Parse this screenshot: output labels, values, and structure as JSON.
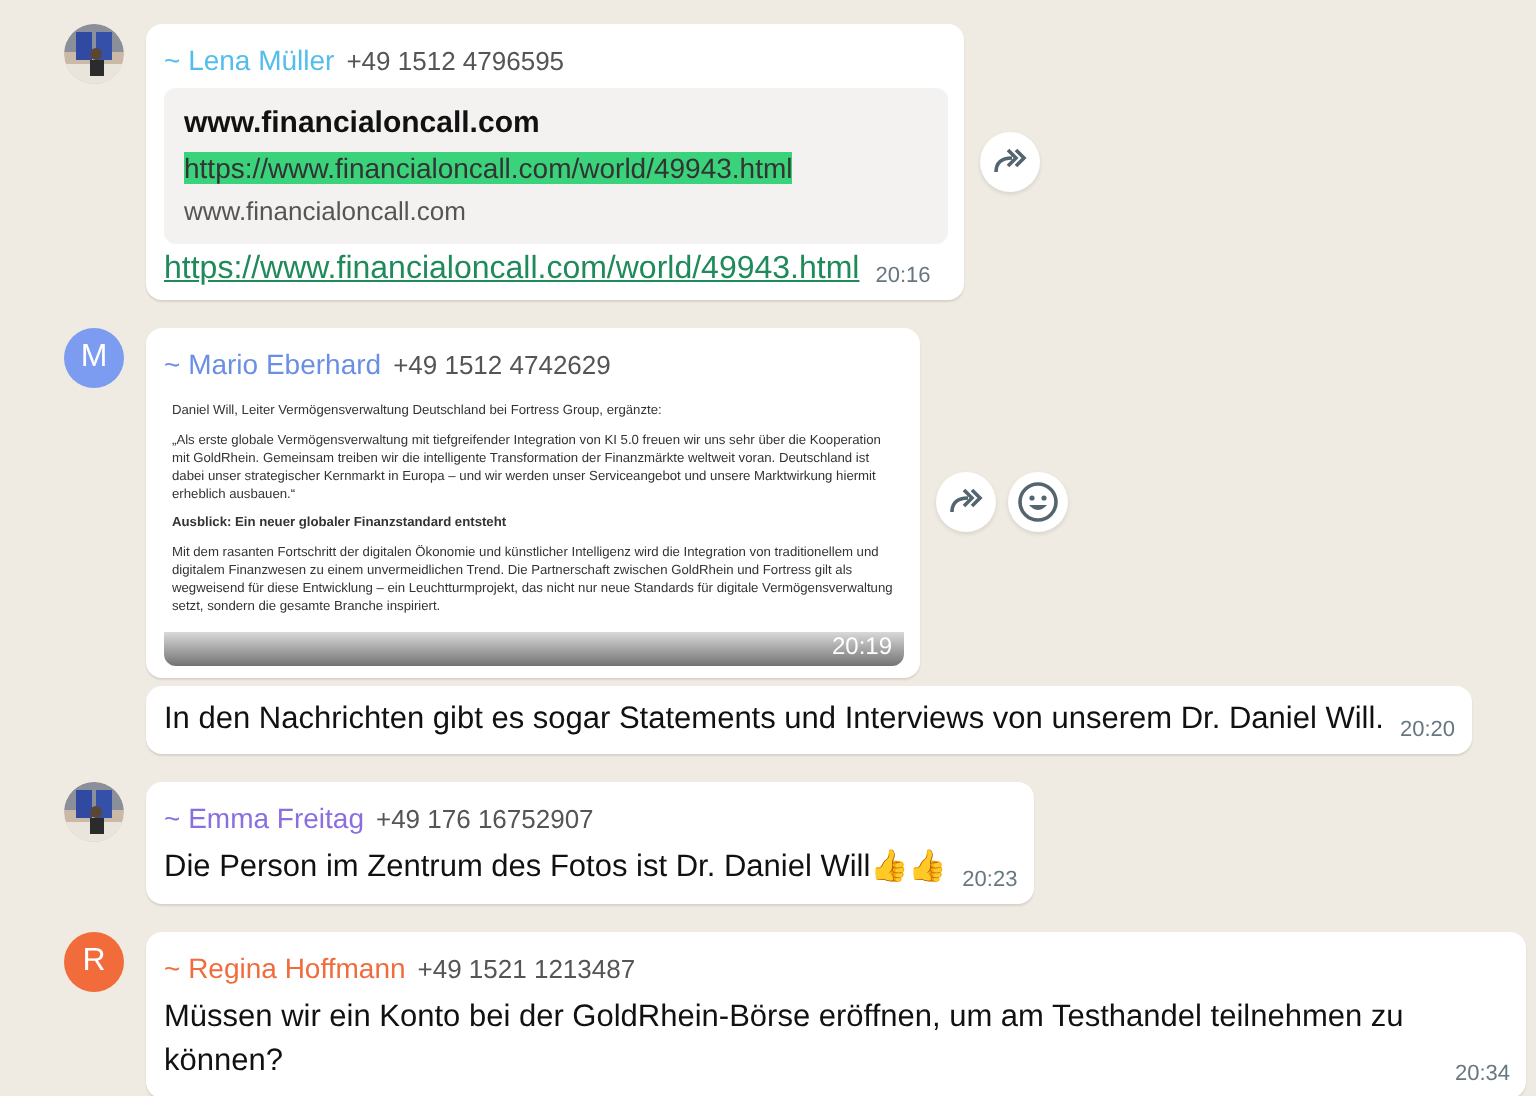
{
  "messages": [
    {
      "kind": "link",
      "sender": {
        "name": "~ Lena Müller",
        "phone": "+49 1512 4796595",
        "color": "#53bdeb"
      },
      "preview": {
        "title": "www.financialoncall.com",
        "url": "https://www.financialoncall.com/world/49943.html",
        "domain": "www.financialoncall.com",
        "highlighted": true
      },
      "text": "https://www.financialoncall.com/world/49943.html",
      "time": "20:16",
      "forward": true,
      "react": false
    },
    {
      "sender": {
        "name": "~ Mario Eberhard",
        "phone": "+49 1512 4742629",
        "color": "#6c8fe6"
      },
      "avatar": {
        "kind": "letter",
        "letter": "M",
        "color": "#7b9cf0"
      },
      "document": [
        {
          "kind": "text",
          "text": "Daniel Will, Leiter Vermögensverwaltung Deutschland bei Fortress Group, ergänzte:"
        },
        {
          "kind": "text",
          "text": "„Als erste globale Vermögensverwaltung mit tiefgreifender Integration von KI 5.0 freuen wir uns sehr über die Kooperation mit GoldRhein. Gemeinsam treiben wir die intelligente Transformation der Finanzmärkte weltweit voran. Deutschland ist dabei unser strategischer Kernmarkt in Europa – und wir werden unser Serviceangebot und unsere Marktwirkung hiermit erheblich ausbauen.“"
        },
        {
          "kind": "heading",
          "text": "Ausblick: Ein neuer globaler Finanzstandard entsteht"
        },
        {
          "kind": "text",
          "text": "Mit dem rasanten Fortschritt der digitalen Ökonomie und künstlicher Intelligenz wird die Integration von traditionellem und digitalem Finanzwesen zu einem unvermeidlichen Trend. Die Partnerschaft zwischen GoldRhein und Fortress gilt als wegweisend für diese Entwicklung – ein Leuchtturmprojekt, das nicht nur neue Standards für digitale Vermögensverwaltung setzt, sondern die gesamte Branche inspiriert."
        }
      ],
      "time": "20:19",
      "forward": true,
      "react": true
    },
    {
      "kind": "text",
      "text": "In den Nachrichten gibt es sogar Statements und Interviews von unserem Dr. Daniel Will.",
      "time": "20:20",
      "forward": false,
      "react": false
    },
    {
      "kind": "text",
      "sender": {
        "name": "~ Emma Freitag",
        "phone": "+49 176 16752907",
        "color": "#8b6fe0"
      },
      "text": "Die Person im Zentrum des Fotos ist Dr. Daniel Will👍👍",
      "time": "20:23",
      "forward": false,
      "react": false
    },
    {
      "kind": "text",
      "sender": {
        "name": "~ Regina Hoffmann",
        "phone": "+49 1521 1213487",
        "color": "#f06c3c"
      },
      "avatar": {
        "kind": "letter",
        "letter": "R",
        "color": "#f26b3a"
      },
      "text": "Müssen wir ein Konto bei der GoldRhein-Börse eröffnen, um am Testhandel teilnehmen zu können?",
      "time": "20:34",
      "forward": false,
      "react": false
    }
  ]
}
